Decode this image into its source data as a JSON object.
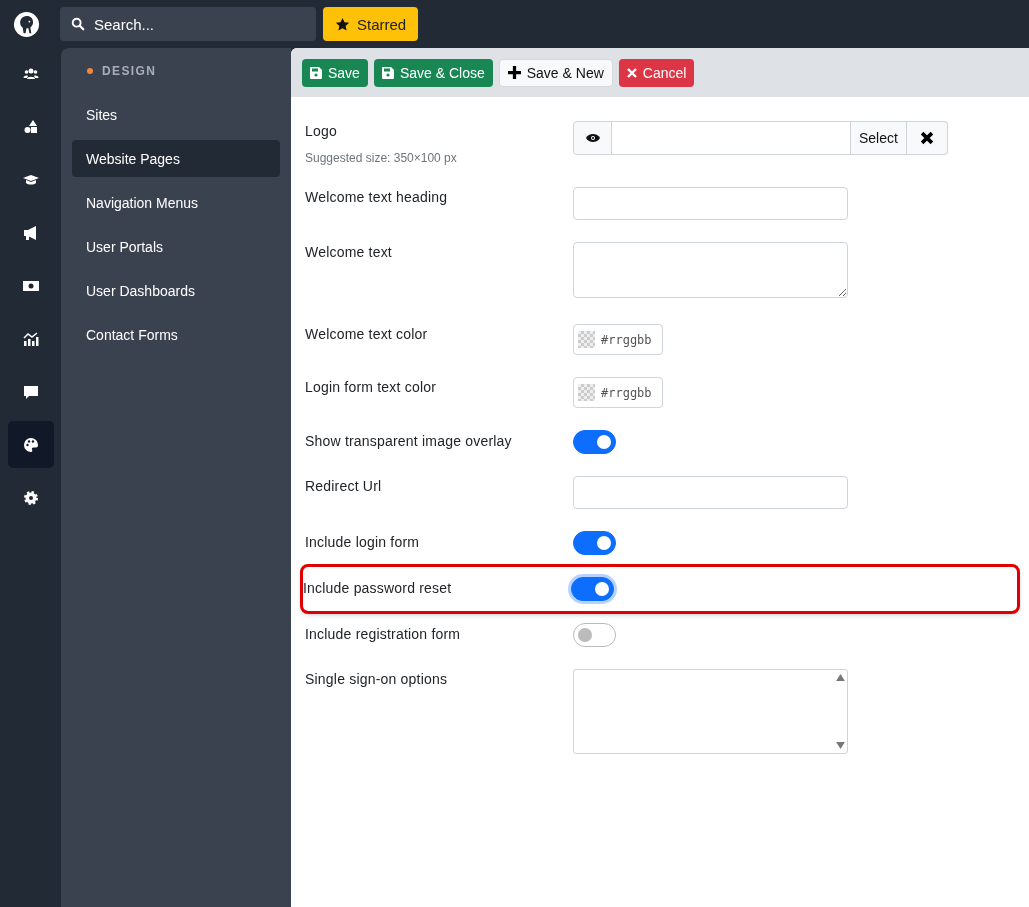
{
  "top_bar": {
    "search": {
      "placeholder": "Search..."
    },
    "starred_button": "Starred"
  },
  "rail": [
    {
      "selected": false
    },
    {
      "selected": false
    },
    {
      "selected": false
    },
    {
      "selected": false
    },
    {
      "selected": false
    },
    {
      "selected": false
    },
    {
      "selected": false
    },
    {
      "selected": true
    },
    {
      "selected": false
    }
  ],
  "sidebar": {
    "heading": "DESIGN",
    "items": [
      {
        "label": "Sites",
        "selected": false
      },
      {
        "label": "Website Pages",
        "selected": true
      },
      {
        "label": "Navigation Menus",
        "selected": false
      },
      {
        "label": "User Portals",
        "selected": false
      },
      {
        "label": "User Dashboards",
        "selected": false
      },
      {
        "label": "Contact Forms",
        "selected": false
      }
    ]
  },
  "toolbar": [
    {
      "kind": "save",
      "label": "Save"
    },
    {
      "kind": "save",
      "label": "Save & Close"
    },
    {
      "kind": "new",
      "label": "Save & New"
    },
    {
      "kind": "cancel",
      "label": "Cancel"
    }
  ],
  "form": [
    {
      "kind": "file",
      "label": "Logo",
      "hint": "Suggested size: 350×100 px",
      "button": "Select",
      "highlighted": false
    },
    {
      "kind": "text",
      "label": "Welcome text heading",
      "highlighted": false
    },
    {
      "kind": "textarea",
      "label": "Welcome text",
      "highlighted": false
    },
    {
      "kind": "color",
      "label": "Welcome text color",
      "placeholder": "#rrggbb",
      "highlighted": false
    },
    {
      "kind": "color",
      "label": "Login form text color",
      "placeholder": "#rrggbb",
      "highlighted": false
    },
    {
      "kind": "toggle",
      "label": "Show transparent image overlay",
      "on": true,
      "highlighted": false
    },
    {
      "kind": "text",
      "label": "Redirect Url",
      "highlighted": false
    },
    {
      "kind": "toggle",
      "label": "Include login form",
      "on": true,
      "highlighted": false
    },
    {
      "kind": "toggle",
      "label": "Include password reset",
      "on": true,
      "highlighted": true
    },
    {
      "kind": "toggle",
      "label": "Include registration form",
      "on": false,
      "highlighted": false
    },
    {
      "kind": "listbox",
      "label": "Single sign-on options",
      "highlighted": false
    }
  ]
}
